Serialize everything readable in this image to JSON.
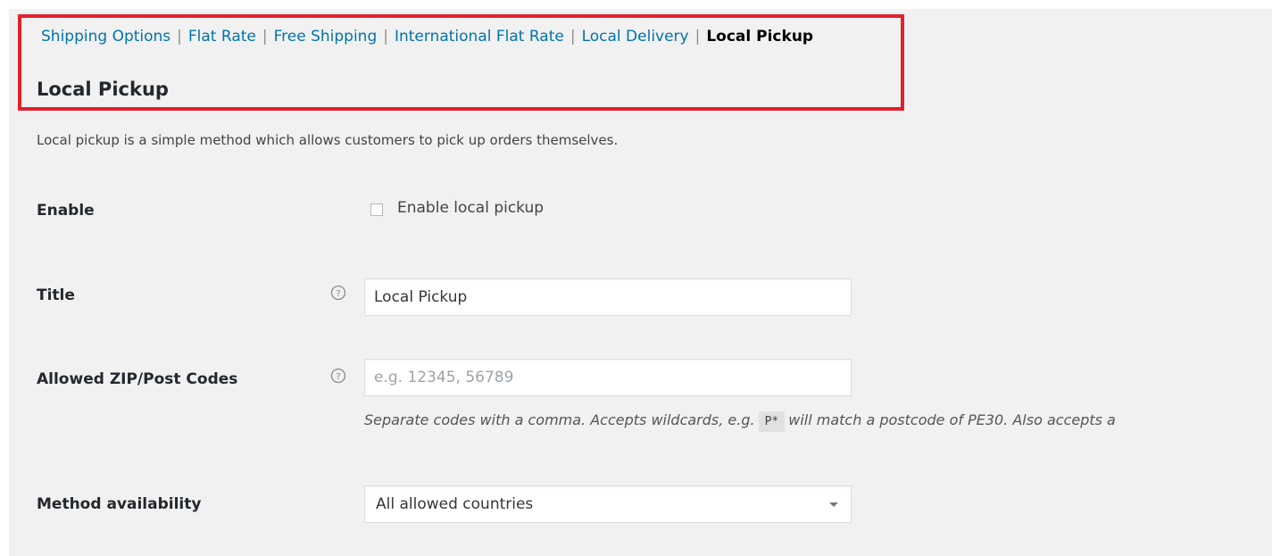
{
  "subnav": {
    "items": [
      {
        "label": "Shipping Options"
      },
      {
        "label": "Flat Rate"
      },
      {
        "label": "Free Shipping"
      },
      {
        "label": "International Flat Rate"
      },
      {
        "label": "Local Delivery"
      },
      {
        "label": "Local Pickup"
      }
    ],
    "separator": "|",
    "current_index": 5
  },
  "section": {
    "title": "Local Pickup",
    "description": "Local pickup is a simple method which allows customers to pick up orders themselves."
  },
  "fields": {
    "enable": {
      "label": "Enable",
      "checkbox_label": "Enable local pickup",
      "checked": false
    },
    "title": {
      "label": "Title",
      "value": "Local Pickup",
      "help_icon": "help-icon"
    },
    "zip": {
      "label": "Allowed ZIP/Post Codes",
      "value": "",
      "placeholder": "e.g. 12345, 56789",
      "help_icon": "help-icon",
      "desc_before": "Separate codes with a comma. Accepts wildcards, e.g.",
      "desc_code": "P*",
      "desc_after": "will match a postcode of PE30. Also accepts a"
    },
    "availability": {
      "label": "Method availability",
      "selected": "All allowed countries"
    }
  },
  "colors": {
    "link": "#0073aa",
    "highlight_border": "#e3202c",
    "background": "#f1f1f1"
  }
}
